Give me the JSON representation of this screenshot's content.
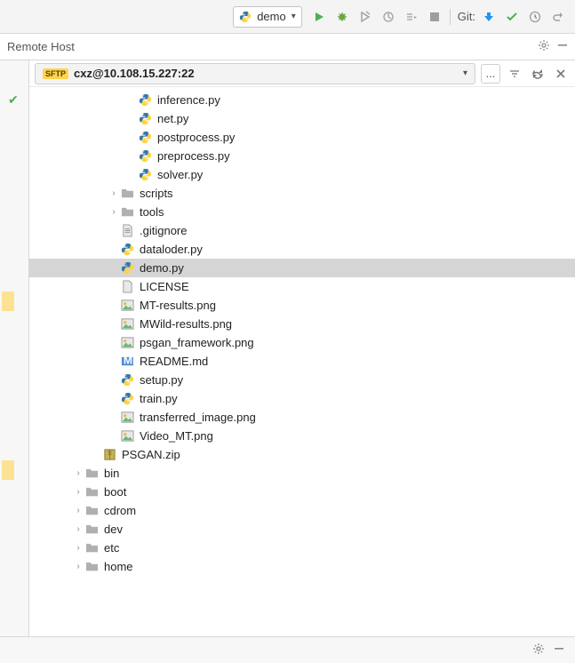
{
  "top_toolbar": {
    "run_config": "demo",
    "git_label": "Git:"
  },
  "panel": {
    "title": "Remote Host"
  },
  "host_bar": {
    "badge": "SFTP",
    "host": "cxz@10.108.15.227:22",
    "more": "..."
  },
  "tree": [
    {
      "indent": 5,
      "icon": "py",
      "name": "inference.py"
    },
    {
      "indent": 5,
      "icon": "py",
      "name": "net.py"
    },
    {
      "indent": 5,
      "icon": "py",
      "name": "postprocess.py"
    },
    {
      "indent": 5,
      "icon": "py",
      "name": "preprocess.py"
    },
    {
      "indent": 5,
      "icon": "py",
      "name": "solver.py"
    },
    {
      "indent": 4,
      "icon": "folder",
      "name": "scripts",
      "expandable": true,
      "expanded": false
    },
    {
      "indent": 4,
      "icon": "folder",
      "name": "tools",
      "expandable": true,
      "expanded": false
    },
    {
      "indent": 4,
      "icon": "txt",
      "name": ".gitignore"
    },
    {
      "indent": 4,
      "icon": "py",
      "name": "dataloder.py"
    },
    {
      "indent": 4,
      "icon": "py",
      "name": "demo.py",
      "selected": true
    },
    {
      "indent": 4,
      "icon": "file",
      "name": "LICENSE"
    },
    {
      "indent": 4,
      "icon": "img",
      "name": "MT-results.png"
    },
    {
      "indent": 4,
      "icon": "img",
      "name": "MWild-results.png"
    },
    {
      "indent": 4,
      "icon": "img",
      "name": "psgan_framework.png"
    },
    {
      "indent": 4,
      "icon": "md",
      "name": "README.md"
    },
    {
      "indent": 4,
      "icon": "py",
      "name": "setup.py"
    },
    {
      "indent": 4,
      "icon": "py",
      "name": "train.py"
    },
    {
      "indent": 4,
      "icon": "img",
      "name": "transferred_image.png"
    },
    {
      "indent": 4,
      "icon": "img",
      "name": "Video_MT.png"
    },
    {
      "indent": 3,
      "icon": "zip",
      "name": "PSGAN.zip"
    },
    {
      "indent": 2,
      "icon": "folder",
      "name": "bin",
      "expandable": true,
      "expanded": false
    },
    {
      "indent": 2,
      "icon": "folder",
      "name": "boot",
      "expandable": true,
      "expanded": false
    },
    {
      "indent": 2,
      "icon": "folder",
      "name": "cdrom",
      "expandable": true,
      "expanded": false
    },
    {
      "indent": 2,
      "icon": "folder",
      "name": "dev",
      "expandable": true,
      "expanded": false
    },
    {
      "indent": 2,
      "icon": "folder",
      "name": "etc",
      "expandable": true,
      "expanded": false
    },
    {
      "indent": 2,
      "icon": "folder",
      "name": "home",
      "expandable": true,
      "expanded": false
    }
  ]
}
